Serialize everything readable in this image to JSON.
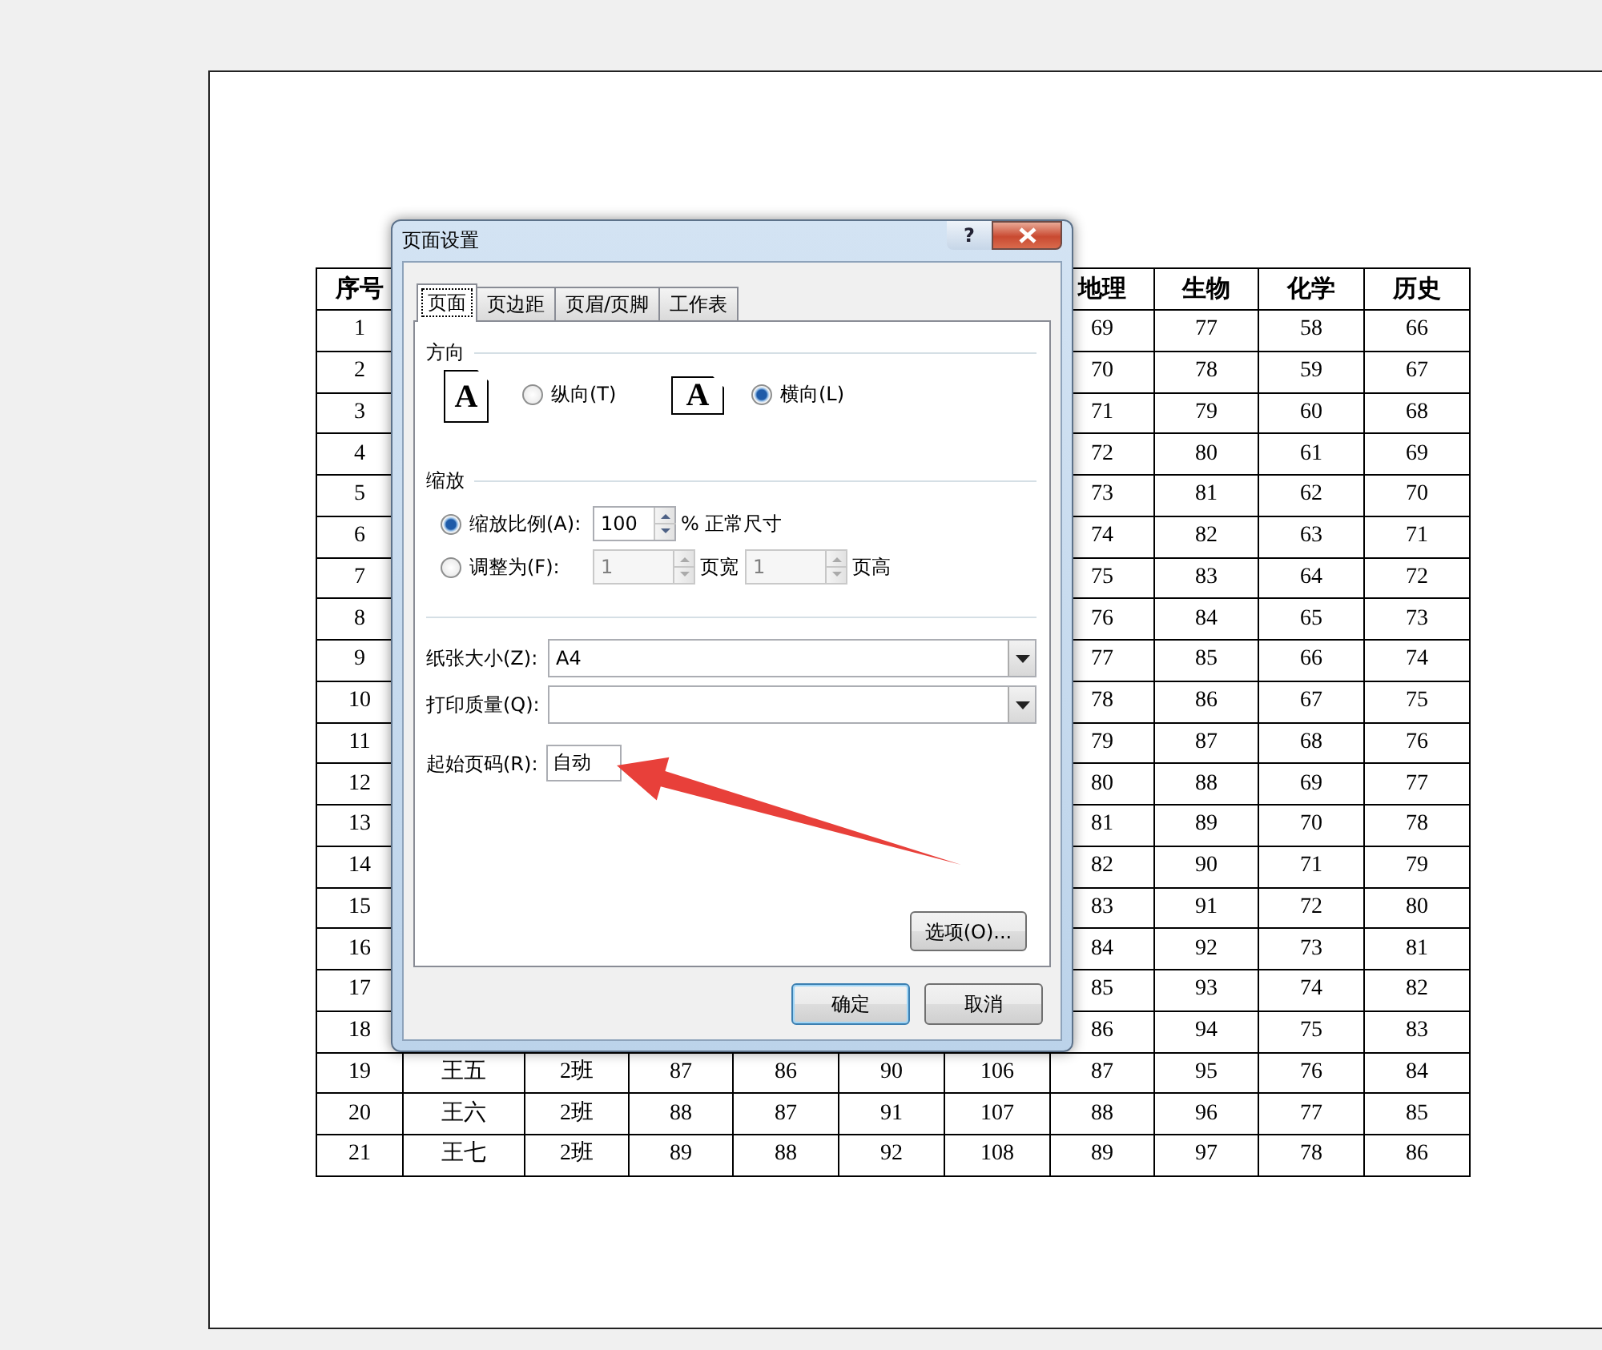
{
  "sheet": {
    "table": {
      "header": [
        "序号",
        "地理",
        "生物",
        "化学",
        "历史"
      ],
      "rows": [
        {
          "cells": [
            "1",
            "69",
            "77",
            "58",
            "66"
          ]
        },
        {
          "cells": [
            "2",
            "70",
            "78",
            "59",
            "67"
          ]
        },
        {
          "cells": [
            "3",
            "71",
            "79",
            "60",
            "68"
          ]
        },
        {
          "cells": [
            "4",
            "72",
            "80",
            "61",
            "69"
          ]
        },
        {
          "cells": [
            "5",
            "73",
            "81",
            "62",
            "70"
          ]
        },
        {
          "cells": [
            "6",
            "74",
            "82",
            "63",
            "71"
          ]
        },
        {
          "cells": [
            "7",
            "75",
            "83",
            "64",
            "72"
          ]
        },
        {
          "cells": [
            "8",
            "76",
            "84",
            "65",
            "73"
          ]
        },
        {
          "cells": [
            "9",
            "77",
            "85",
            "66",
            "74"
          ]
        },
        {
          "cells": [
            "10",
            "78",
            "86",
            "67",
            "75"
          ]
        },
        {
          "cells": [
            "11",
            "79",
            "87",
            "68",
            "76"
          ]
        },
        {
          "cells": [
            "12",
            "80",
            "88",
            "69",
            "77"
          ]
        },
        {
          "cells": [
            "13",
            "81",
            "89",
            "70",
            "78"
          ]
        },
        {
          "cells": [
            "14",
            "82",
            "90",
            "71",
            "79"
          ]
        },
        {
          "cells": [
            "15",
            "83",
            "91",
            "72",
            "80"
          ]
        },
        {
          "cells": [
            "16",
            "84",
            "92",
            "73",
            "81"
          ]
        },
        {
          "cells": [
            "17",
            "85",
            "93",
            "74",
            "82"
          ]
        },
        {
          "cells": [
            "18",
            "86",
            "94",
            "75",
            "83"
          ]
        },
        {
          "cells": [
            "19",
            "王五",
            "2班",
            "87",
            "86",
            "90",
            "106",
            "87",
            "95",
            "76",
            "84"
          ]
        },
        {
          "cells": [
            "20",
            "王六",
            "2班",
            "88",
            "87",
            "91",
            "107",
            "88",
            "96",
            "77",
            "85"
          ]
        },
        {
          "cells": [
            "21",
            "王七",
            "2班",
            "89",
            "88",
            "92",
            "108",
            "89",
            "97",
            "78",
            "86"
          ]
        }
      ]
    }
  },
  "dialog": {
    "title": "页面设置",
    "help_glyph": "?",
    "tabs": [
      {
        "label": "页面",
        "selected": true
      },
      {
        "label": "页边距",
        "selected": false
      },
      {
        "label": "页眉/页脚",
        "selected": false
      },
      {
        "label": "工作表",
        "selected": false
      }
    ],
    "orientation": {
      "label": "方向",
      "options": [
        {
          "kind": "portrait",
          "icon_letter": "A",
          "label": "纵向(T)",
          "selected": false
        },
        {
          "kind": "landscape",
          "icon_letter": "A",
          "label": "横向(L)",
          "selected": true
        }
      ]
    },
    "scaling": {
      "label": "缩放",
      "options": [
        {
          "label": "缩放比例(A):",
          "selected": true,
          "fields": [
            {
              "value": "100",
              "unit": "% 正常尺寸",
              "disabled": false
            }
          ]
        },
        {
          "label": "调整为(F):",
          "selected": false,
          "fields": [
            {
              "value": "1",
              "unit": "页宽",
              "disabled": true
            },
            {
              "value": "1",
              "unit": "页高",
              "disabled": true
            }
          ]
        }
      ]
    },
    "paper_size": {
      "label": "纸张大小(Z):",
      "value": "A4"
    },
    "print_quality": {
      "label": "打印质量(Q):"
    },
    "first_page_number": {
      "label": "起始页码(R):",
      "value": "自动"
    },
    "options_button": "选项(O)...",
    "buttons": [
      {
        "label": "确定",
        "default": true
      },
      {
        "label": "取消",
        "default": false
      }
    ]
  }
}
